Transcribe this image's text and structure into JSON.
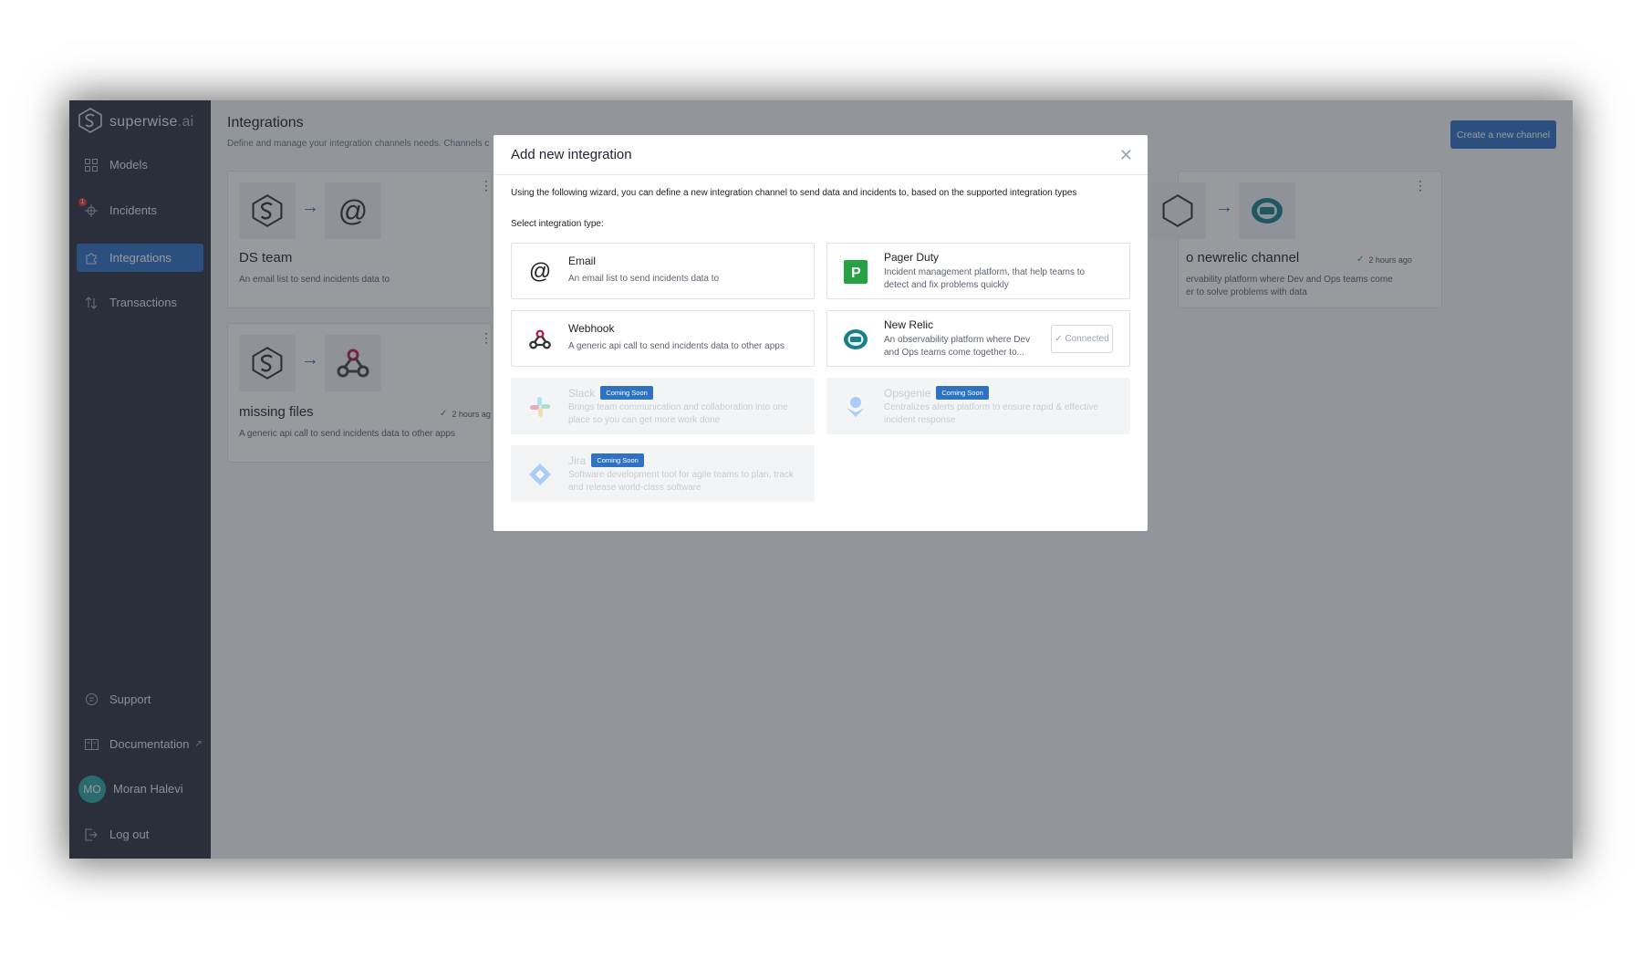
{
  "app": {
    "name": "superwise",
    "name_suffix": ".ai"
  },
  "sidebar": {
    "items": [
      {
        "label": "Models",
        "icon": "grid-icon"
      },
      {
        "label": "Incidents",
        "icon": "crosshair-icon",
        "badge": "1"
      },
      {
        "label": "Integrations",
        "icon": "puzzle-icon",
        "active": true
      },
      {
        "label": "Transactions",
        "icon": "transactions-icon"
      }
    ],
    "bottom": {
      "support": "Support",
      "documentation": "Documentation",
      "user_initials": "MO",
      "user_name": "Moran Halevi",
      "logout": "Log out"
    }
  },
  "header": {
    "title": "Integrations",
    "subtitle": "Define and manage your integration channels needs. Channels c",
    "create_button": "Create a new channel"
  },
  "cards": [
    {
      "name": "DS team",
      "desc": "An email list to send incidents data to",
      "target_icon": "at-icon"
    },
    {
      "name": "missing files",
      "desc": "A generic api call to send incidents data to other apps",
      "target_icon": "webhook-icon",
      "ago": "2 hours ag"
    },
    {
      "name": "o newrelic channel",
      "desc_line1": "ervability platform where Dev and Ops teams come",
      "desc_line2": "er to solve problems with data",
      "target_icon": "newrelic-icon",
      "ago": "2 hours ago"
    }
  ],
  "modal": {
    "title": "Add new integration",
    "intro": "Using the following wizard, you can define a new integration channel to send data and incidents to, based on the supported integration types",
    "select_label": "Select integration type:",
    "coming_soon": "Coming Soon",
    "options": [
      {
        "name": "Email",
        "desc": "An email list to send incidents data to",
        "icon": "at-icon"
      },
      {
        "name": "Pager Duty",
        "desc": "Incident management platform, that help teams to detect and fix problems quickly",
        "icon": "pagerduty-icon",
        "color": "#25a244"
      },
      {
        "name": "Webhook",
        "desc": "A generic api call to send incidents data to other apps",
        "icon": "webhook-icon"
      },
      {
        "name": "New Relic",
        "desc": "An observability platform where Dev and Ops teams come together to...",
        "icon": "newrelic-icon",
        "status": "✓ Connected"
      },
      {
        "name": "Slack",
        "desc": "Brings team communication and collaboration into one place so you can get more work done",
        "icon": "slack-icon"
      },
      {
        "name": "Opsgenie",
        "desc": "Centralizes alerts platform to ensure rapid & effective incident response",
        "icon": "opsgenie-icon"
      },
      {
        "name": "Jira",
        "desc": "Software development tool for agile teams to plan, track and release world-class software",
        "icon": "jira-icon"
      }
    ]
  },
  "colors": {
    "accent": "#2f72c4",
    "sidebar": "#2c3242",
    "avatar": "#2fa6a8",
    "badge": "#e53935"
  }
}
